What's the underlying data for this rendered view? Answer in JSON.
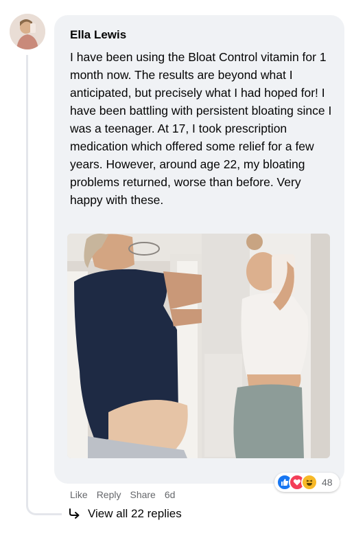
{
  "comment": {
    "author": "Ella Lewis",
    "text": "I have been using the Bloat Control vitamin for 1 month now. The results are beyond what I anticipated, but precisely what I had hoped for! I have been battling with persistent bloating since I was a teenager. At 17, I took prescription medication which offered some relief for a few years. However, around age 22, my bloating problems returned, worse than before. Very happy with these.",
    "reactions": {
      "icons": [
        "like-icon",
        "love-icon",
        "haha-icon"
      ],
      "count": "48",
      "colors": {
        "like": "#1877f2",
        "love": "#f33e58",
        "haha": "#f7b928"
      }
    },
    "actions": {
      "like": "Like",
      "reply": "Reply",
      "share": "Share",
      "time": "6d"
    },
    "replies_link": "View all 22 replies"
  },
  "colors": {
    "bubble": "#f0f2f5",
    "thread_line": "#e4e6eb",
    "secondary_text": "#65676b"
  }
}
